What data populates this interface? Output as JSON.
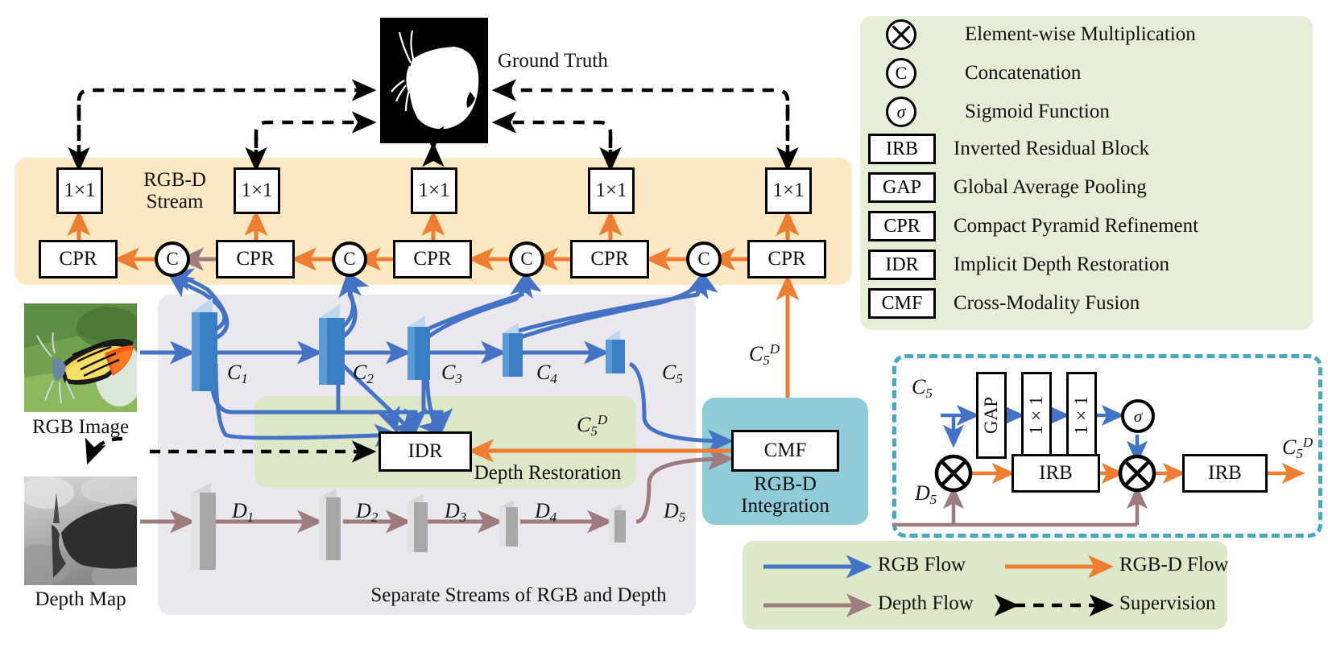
{
  "panels": {
    "rgbd_stream": "RGB-D\nStream",
    "rgbd_stream_l1": "RGB-D",
    "rgbd_stream_l2": "Stream",
    "separate_streams": "Separate Streams of RGB and Depth",
    "depth_restoration": "Depth Restoration",
    "integration_l1": "RGB-D",
    "integration_l2": "Integration"
  },
  "inputs": {
    "rgb_caption": "RGB Image",
    "depth_caption": "Depth Map",
    "gt_caption": "Ground Truth"
  },
  "decoder": {
    "conv_label": "1×1",
    "cpr_label": "CPR",
    "concat_label": "C",
    "conv_blocks": [
      "1×1",
      "1×1",
      "1×1",
      "1×1",
      "1×1"
    ],
    "cpr_blocks": [
      "CPR",
      "CPR",
      "CPR",
      "CPR",
      "CPR"
    ],
    "concat_nodes": [
      "C",
      "C",
      "C",
      "C"
    ]
  },
  "backbone": {
    "rgb_labels": [
      "C1",
      "C2",
      "C3",
      "C4",
      "C5"
    ],
    "depth_labels": [
      "D1",
      "D2",
      "D3",
      "D4",
      "D5"
    ],
    "rgb_base": "C",
    "depth_base": "D",
    "rgb_indices": [
      "1",
      "2",
      "3",
      "4",
      "5"
    ],
    "depth_indices": [
      "1",
      "2",
      "3",
      "4",
      "5"
    ]
  },
  "modules": {
    "idr": "IDR",
    "cmf": "CMF",
    "c5d_base": "C",
    "c5d_sub": "5",
    "c5d_sup": "D"
  },
  "cmf_detail": {
    "input_rgb_base": "C",
    "input_rgb_sub": "5",
    "input_depth_base": "D",
    "input_depth_sub": "5",
    "gap": "GAP",
    "conv1": "1×1",
    "conv2": "1×1",
    "sigmoid": "σ",
    "irb1": "IRB",
    "irb2": "IRB",
    "output_base": "C",
    "output_sub": "5",
    "output_sup": "D"
  },
  "legend": {
    "items": [
      {
        "icon": "multiply-icon",
        "symbol": "⊗",
        "label": "Element-wise Multiplication",
        "kind": "circle"
      },
      {
        "icon": "concat-icon",
        "symbol": "C",
        "label": "Concatenation",
        "kind": "circle"
      },
      {
        "icon": "sigmoid-icon",
        "symbol": "σ",
        "label": "Sigmoid Function",
        "kind": "circle"
      },
      {
        "icon": "irb-box-icon",
        "symbol": "IRB",
        "label": "Inverted Residual Block",
        "kind": "box"
      },
      {
        "icon": "gap-box-icon",
        "symbol": "GAP",
        "label": "Global Average Pooling",
        "kind": "box"
      },
      {
        "icon": "cpr-box-icon",
        "symbol": "CPR",
        "label": "Compact Pyramid Refinement",
        "kind": "box"
      },
      {
        "icon": "idr-box-icon",
        "symbol": "IDR",
        "label": "Implicit Depth Restoration",
        "kind": "box"
      },
      {
        "icon": "cmf-box-icon",
        "symbol": "CMF",
        "label": "Cross-Modality Fusion",
        "kind": "box"
      }
    ]
  },
  "flow_legend": {
    "items": [
      {
        "label": "RGB Flow",
        "color": "#4472c4",
        "style": "solid"
      },
      {
        "label": "RGB-D Flow",
        "color": "#ed7d31",
        "style": "solid"
      },
      {
        "label": "Depth Flow",
        "color": "#9e7b7e",
        "style": "solid"
      },
      {
        "label": "Supervision",
        "color": "#000000",
        "style": "dashed"
      }
    ]
  },
  "colors": {
    "rgb_flow": "#4472c4",
    "rgbd_flow": "#ed7d31",
    "depth_flow": "#9e7b7e",
    "supervision": "#000000",
    "panel_rgbd": "#fce8c3",
    "panel_separate": "#eae7ef",
    "panel_depth_restoration": "#dde8c8",
    "panel_integration": "#8fccd8",
    "panel_legend": "#e5eed6",
    "cmf_dashed_border": "#4aa7bd",
    "feature_rgb": "#3a7fc4",
    "feature_depth": "#b0b0b0"
  }
}
